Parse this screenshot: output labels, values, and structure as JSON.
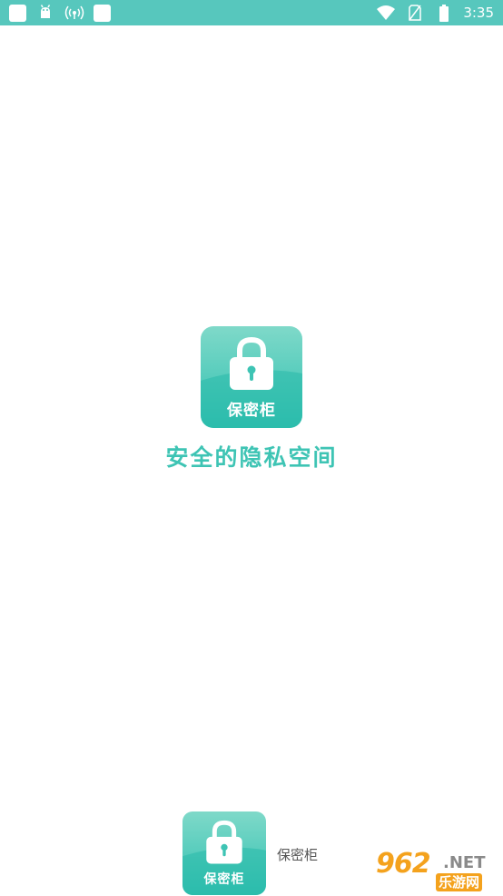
{
  "status_bar": {
    "background": "#57c7bd",
    "left_icons": [
      "notification-square-icon",
      "android-icon",
      "hotspot-icon",
      "notification-square-icon"
    ],
    "right_icons": [
      "wifi-icon",
      "no-sim-icon",
      "battery-icon"
    ],
    "time": "3:35"
  },
  "splash": {
    "logo_label": "保密柜",
    "tagline": "安全的隐私空间",
    "accent_color": "#3ec4b4"
  },
  "footer": {
    "app_name": "保密柜",
    "logo_label": "保密柜"
  },
  "watermark": {
    "number": "962",
    "domain": ".NET",
    "site_name": "乐游网"
  }
}
